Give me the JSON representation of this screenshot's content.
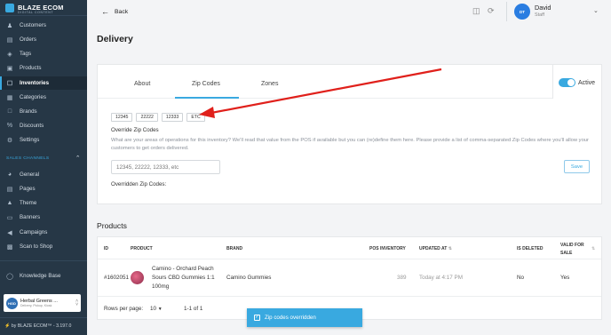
{
  "sidebar": {
    "brand": "BLAZE ECOM",
    "brand_sub": "DIGITAL CONTENT",
    "items": [
      {
        "label": "Customers",
        "icon": "users-icon"
      },
      {
        "label": "Orders",
        "icon": "orders-icon"
      },
      {
        "label": "Tags",
        "icon": "tag-icon"
      },
      {
        "label": "Products",
        "icon": "box-icon"
      },
      {
        "label": "Inventories",
        "icon": "clipboard-icon",
        "active": true
      },
      {
        "label": "Categories",
        "icon": "categories-icon"
      },
      {
        "label": "Brands",
        "icon": "book-icon"
      },
      {
        "label": "Discounts",
        "icon": "discount-icon"
      },
      {
        "label": "Settings",
        "icon": "gear-icon"
      }
    ],
    "sales_channels_label": "SALES CHANNELS",
    "channel_items": [
      {
        "label": "General",
        "icon": "globe-icon"
      },
      {
        "label": "Pages",
        "icon": "pages-icon"
      },
      {
        "label": "Theme",
        "icon": "theme-icon"
      },
      {
        "label": "Banners",
        "icon": "banner-icon"
      },
      {
        "label": "Campaigns",
        "icon": "megaphone-icon"
      },
      {
        "label": "Scan to Shop",
        "icon": "scan-icon"
      }
    ],
    "knowledge_base": "Knowledge Base",
    "store": {
      "initials": "HGD",
      "name": "Herbal Greens ...",
      "sub": "Delivery, Pickup, Kiosk"
    },
    "version": "by BLAZE ECOM™ - 3.197.0"
  },
  "topbar": {
    "back_label": "Back",
    "user_initials": "DT",
    "user_name": "David",
    "user_role": "Staff"
  },
  "page_title": "Delivery",
  "tabs": [
    "About",
    "Zip Codes",
    "Zones"
  ],
  "active_tab": "Zip Codes",
  "active_toggle_label": "Active",
  "zip_chips": [
    "12345",
    "22222",
    "12333",
    "ETC"
  ],
  "override_label": "Override Zip Codes",
  "help_text": "What are your areas of operations for this inventory? We'll read that value from the POS if available but you can (re)define them here. Please provide a list of comma-separated Zip Codes where you'll allow your customers to get orders delivered.",
  "zip_placeholder": "12345, 22222, 12333, etc",
  "save_label": "Save",
  "overridden_label": "Overridden Zip Codes:",
  "products": {
    "title": "Products",
    "headers": {
      "id": "ID",
      "product": "PRODUCT",
      "brand": "BRAND",
      "pos_inventory": "POS INVENTORY",
      "updated_at": "UPDATED AT",
      "is_deleted": "IS DELETED",
      "valid_for_sale_1": "VALID FOR",
      "valid_for_sale_2": "SALE"
    },
    "rows": [
      {
        "id": "#1602051",
        "product_line1": "Camino - Orchard Peach",
        "product_line2": "Sours CBD Gummies 1:1",
        "product_line3": "100mg",
        "brand": "Camino Gummies",
        "pos_inventory": "389",
        "updated_at": "Today at 4:17 PM",
        "is_deleted": "No",
        "valid_for_sale": "Yes"
      }
    ],
    "rows_per_page_label": "Rows per page:",
    "rows_per_page": "10",
    "range": "1-1 of 1"
  },
  "toast": "Zip codes overridden",
  "colors": {
    "accent": "#39a9e0",
    "sidebar": "#263746",
    "arrow": "#e0201b"
  }
}
